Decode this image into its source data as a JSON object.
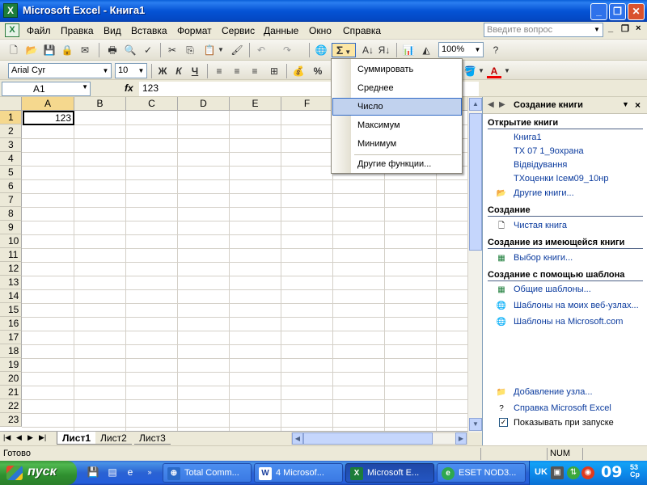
{
  "window": {
    "title": "Microsoft Excel - Книга1",
    "minimize": "_",
    "maximize": "❐",
    "close": "✕"
  },
  "menu": {
    "items": [
      "Файл",
      "Правка",
      "Вид",
      "Вставка",
      "Формат",
      "Сервис",
      "Данные",
      "Окно",
      "Справка"
    ],
    "ask_placeholder": "Введите вопрос",
    "doc_minimize": "_",
    "doc_restore": "❐",
    "doc_close": "×"
  },
  "toolbar": {
    "zoom": "100%",
    "font": "Arial Cyr",
    "size": "10",
    "bold": "Ж",
    "italic": "К",
    "underline": "Ч",
    "sigma": "Σ",
    "percent": "%"
  },
  "formula_bar": {
    "name_box": "A1",
    "fx": "fx",
    "value": "123"
  },
  "grid": {
    "columns": [
      "A",
      "B",
      "C",
      "D",
      "E",
      "F"
    ],
    "rows": [
      "1",
      "2",
      "3",
      "4",
      "5",
      "6",
      "7",
      "8",
      "9",
      "10",
      "11",
      "12",
      "13",
      "14",
      "15",
      "16",
      "17",
      "18",
      "19",
      "20",
      "21",
      "22",
      "23"
    ],
    "a1_value": "123"
  },
  "autosum_menu": {
    "items": [
      "Суммировать",
      "Среднее",
      "Число",
      "Максимум",
      "Минимум",
      "Другие функции..."
    ],
    "highlighted": "Число"
  },
  "sheets": {
    "tabs": [
      "Лист1",
      "Лист2",
      "Лист3"
    ],
    "active": "Лист1"
  },
  "status": {
    "ready": "Готово",
    "num": "NUM"
  },
  "task_pane": {
    "title": "Создание книги",
    "open_section": "Открытие книги",
    "recent": [
      "Книга1",
      "ТХ 07 1_9охрана",
      "Відвідування",
      "ТХоценки Iсем09_10нр"
    ],
    "more_books": "Другие книги...",
    "new_section": "Создание",
    "blank": "Чистая книга",
    "existing_section": "Создание из имеющейся книги",
    "choose": "Выбор книги...",
    "template_section": "Создание с помощью шаблона",
    "templates": [
      "Общие шаблоны...",
      "Шаблоны на моих веб-узлах...",
      "Шаблоны на Microsoft.com"
    ],
    "add_place": "Добавление узла...",
    "help": "Справка Microsoft Excel",
    "show_startup": "Показывать при запуске"
  },
  "taskbar": {
    "start": "пуск",
    "buttons": [
      "Total Comm...",
      "4 Microsof...",
      "Microsoft E...",
      "ESET NOD3..."
    ],
    "lang": "UK",
    "clock": "09",
    "clock_min": "53",
    "day": "Ср"
  }
}
